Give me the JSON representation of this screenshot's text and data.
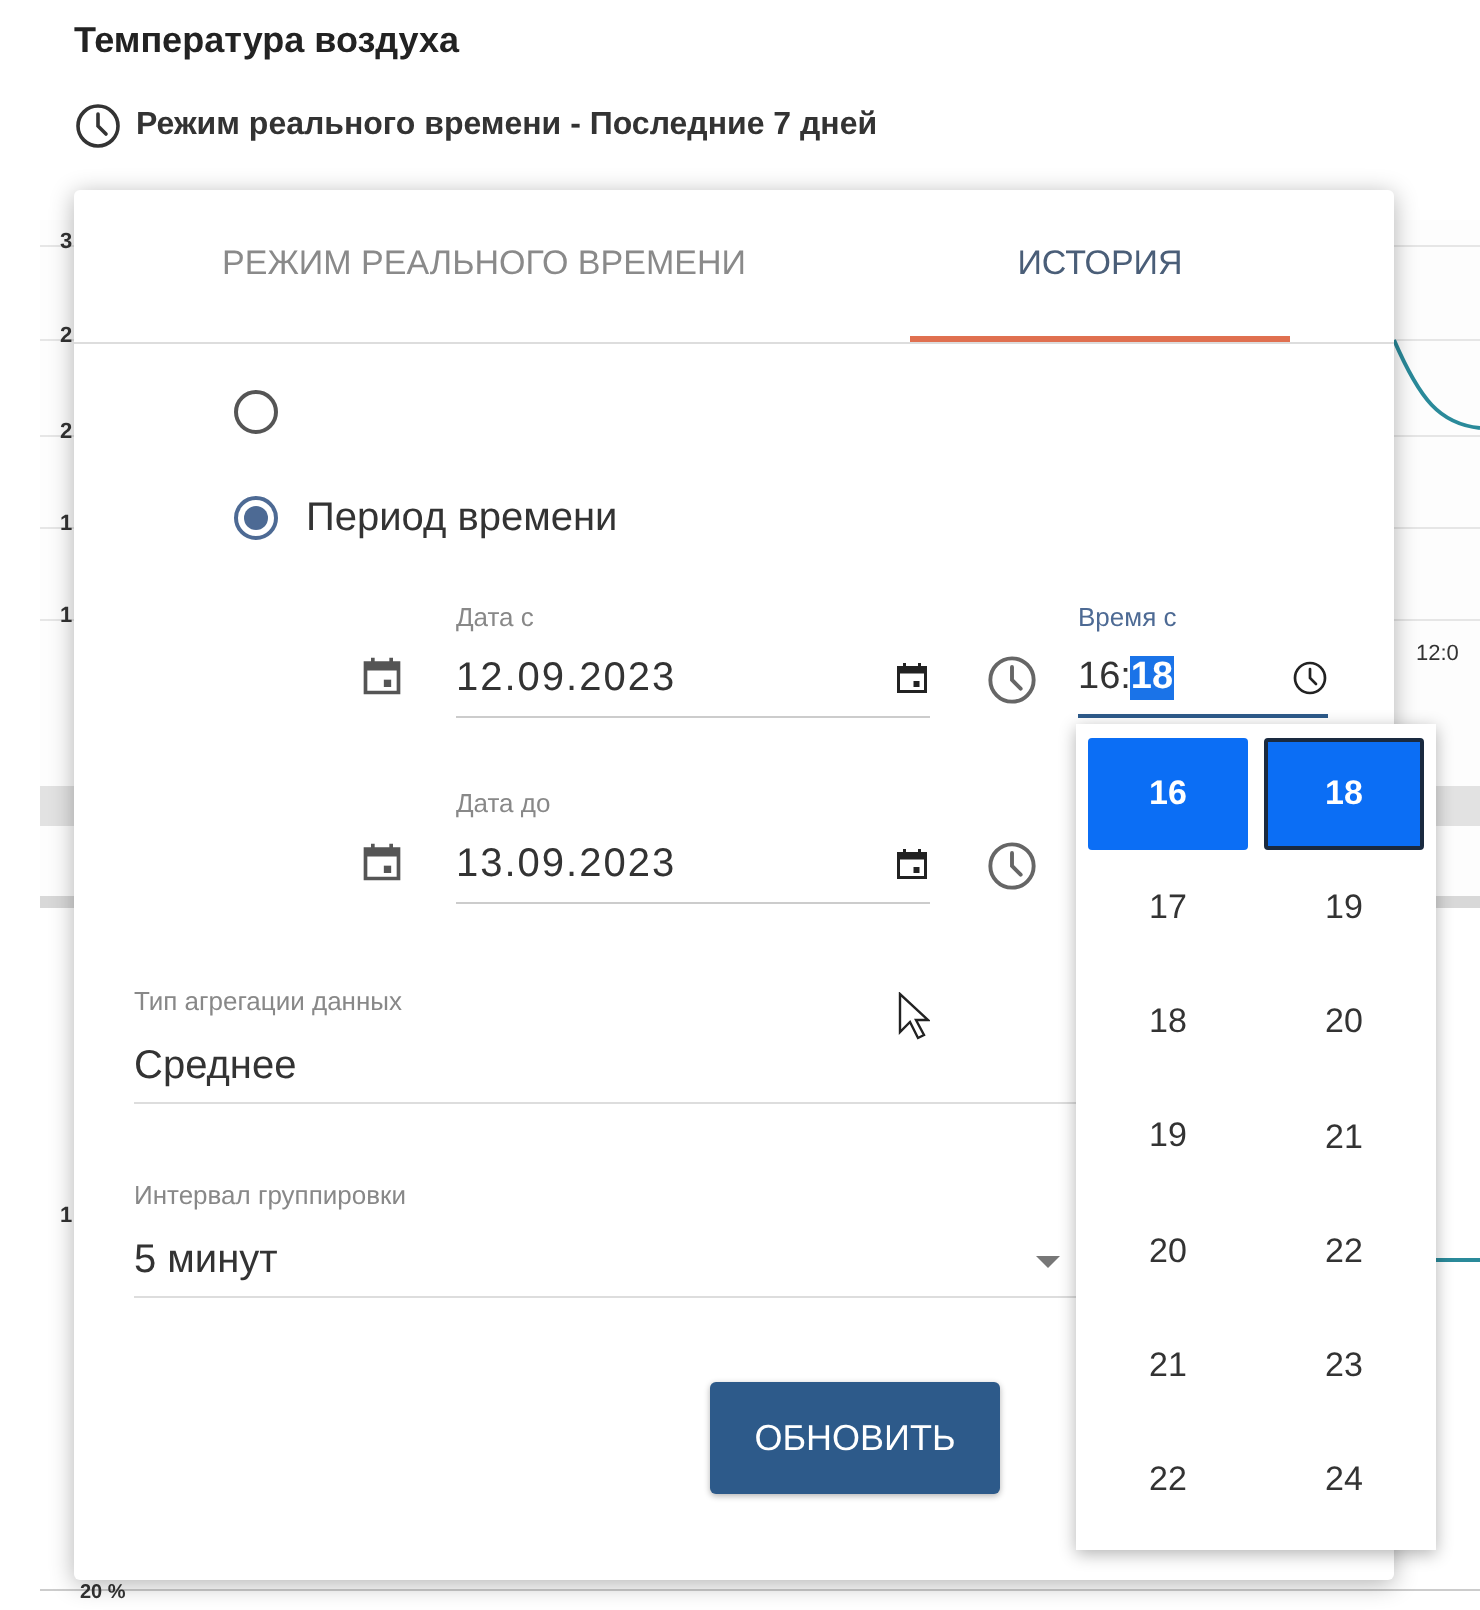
{
  "header": {
    "title": "Температура воздуха",
    "subtitle": "Режим реального времени - Последние 7 дней"
  },
  "background_chart": {
    "tick_labels": [
      "3",
      "2",
      "2",
      "1",
      "1",
      "1"
    ],
    "time_label": "12:0",
    "percent_label": "20 %"
  },
  "dialog": {
    "tabs": [
      {
        "label": "РЕЖИМ РЕАЛЬНОГО ВРЕМЕНИ",
        "selected": false
      },
      {
        "label": "ИСТОРИЯ",
        "selected": true
      }
    ],
    "radios": [
      {
        "selected": false
      },
      {
        "label": "Период времени",
        "selected": true
      }
    ],
    "date_rows": [
      {
        "date_label": "Дата с",
        "date_value": "12.09.2023",
        "time_label": "Время с",
        "time_parts": [
          {
            "text": "16:",
            "selected": false
          },
          {
            "text": "18",
            "selected": true
          }
        ]
      },
      {
        "date_label": "Дата до",
        "date_value": "13.09.2023"
      }
    ],
    "fields": [
      {
        "kind": "text",
        "label": "Тип агрегации данных",
        "value": "Среднее"
      },
      {
        "kind": "select",
        "label": "Интервал группировки",
        "value": "5 минут"
      }
    ],
    "button": "ОБНОВИТЬ"
  },
  "time_dropdown": {
    "columns": [
      {
        "focused": false,
        "items": [
          {
            "text": "16",
            "selected": true
          },
          {
            "text": "17",
            "selected": false
          },
          {
            "text": "18",
            "selected": false
          },
          {
            "text": "19",
            "selected": false
          },
          {
            "text": "20",
            "selected": false
          },
          {
            "text": "21",
            "selected": false
          },
          {
            "text": "22",
            "selected": false
          }
        ]
      },
      {
        "focused": true,
        "items": [
          {
            "text": "18",
            "selected": true
          },
          {
            "text": "19",
            "selected": false
          },
          {
            "text": "20",
            "selected": false
          },
          {
            "text": "21",
            "selected": false
          },
          {
            "text": "22",
            "selected": false
          },
          {
            "text": "23",
            "selected": false
          },
          {
            "text": "24",
            "selected": false
          }
        ]
      }
    ]
  }
}
